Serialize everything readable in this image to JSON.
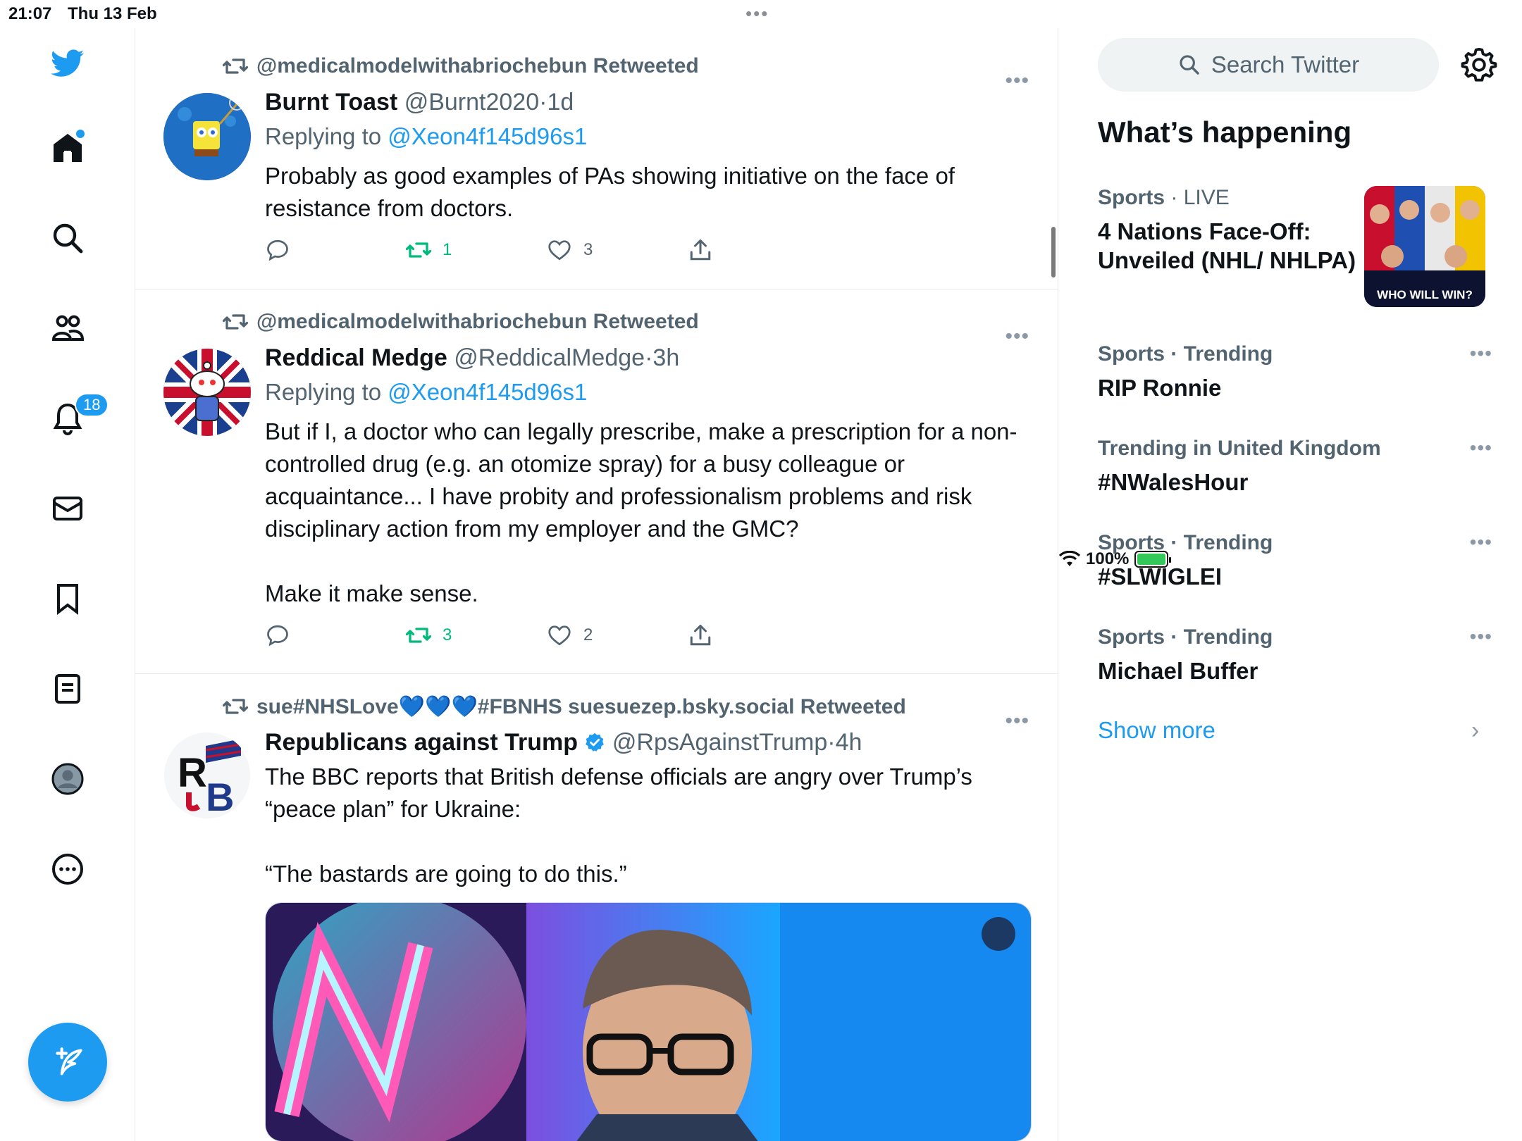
{
  "status_bar": {
    "time": "21:07",
    "date": "Thu 13 Feb",
    "battery": "100%",
    "handle_dots": "•••"
  },
  "nav": {
    "notifications_badge": "18"
  },
  "scroll": {
    "position_fraction": 0.06
  },
  "tweets": [
    {
      "retweeted_by": "@medicalmodelwithabriochebun Retweeted",
      "name": "Burnt Toast",
      "handle": "@Burnt2020",
      "sep": "·",
      "time": "1d",
      "replying_prefix": "Replying to ",
      "replying_to": "@Xeon4f145d96s1",
      "text": "Probably as good examples of PAs showing initiative on the face of resistance from doctors.",
      "retweets": "1",
      "likes": "3"
    },
    {
      "retweeted_by": "@medicalmodelwithabriochebun Retweeted",
      "name": "Reddical Medge",
      "handle": "@ReddicalMedge",
      "sep": "·",
      "time": "3h",
      "replying_prefix": "Replying to ",
      "replying_to": "@Xeon4f145d96s1",
      "text": "But if I, a doctor who can legally prescribe, make a prescription for a non-controlled drug (e.g. an otomize spray) for a busy colleague or acquaintance... I have probity and professionalism problems and risk disciplinary action from my employer and the GMC?\n\nMake it make sense.",
      "retweets": "3",
      "likes": "2"
    },
    {
      "retweeted_by": "sue#NHSLove💙💙💙#FBNHS suesuezep.bsky.social Retweeted",
      "name": "Republicans against Trump",
      "handle": "@RpsAgainstTrump",
      "sep": "·",
      "time": "4h",
      "text": "The BBC reports that British defense officials are angry over Trump’s “peace plan” for Ukraine:\n\n“The bastards are going to do this.”"
    }
  ],
  "sidebar": {
    "search_placeholder": "Search Twitter",
    "section_title": "What’s happening",
    "featured": {
      "category": "Sports",
      "sep": " · ",
      "status": "LIVE",
      "title": "4 Nations Face-Off: Unveiled (NHL/ NHLPA)",
      "image_caption": "WHO WILL WIN?"
    },
    "trends": [
      {
        "meta": "Sports · Trending",
        "title": "RIP Ronnie"
      },
      {
        "meta": "Trending in United Kingdom",
        "title": "#NWalesHour"
      },
      {
        "meta": "Sports · Trending",
        "title": "#SLWIGLEI"
      },
      {
        "meta": "Sports · Trending",
        "title": "Michael Buffer"
      }
    ],
    "show_more": "Show more"
  },
  "colors": {
    "accent": "#1d9bf0",
    "retweet": "#00ba7c",
    "muted": "#536471"
  }
}
